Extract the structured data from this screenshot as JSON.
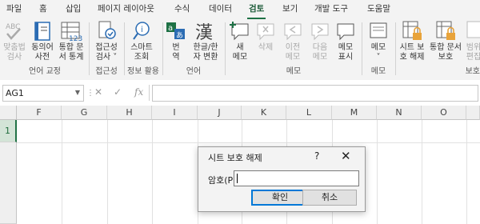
{
  "ribbon_tabs": [
    "파일",
    "홈",
    "삽입",
    "페이지 레이아웃",
    "수식",
    "데이터",
    "검토",
    "보기",
    "개발 도구",
    "도움말"
  ],
  "active_tab": "검토",
  "ribbon": {
    "buttons": {
      "spelling": "맞춤법\n검사",
      "thesaurus": "동의어\n사전",
      "workbook_stats": "통합 문\n서 통계",
      "accessibility": "접근성\n검사 ˅",
      "smart_lookup": "스마트\n조회",
      "translate": "번\n역",
      "hanja": "한글/한\n자 변환",
      "new_comment": "새\n메모",
      "delete_comment": "삭제",
      "prev_comment": "이전\n메모",
      "next_comment": "다음\n메모",
      "show_comments": "메모\n표시",
      "notes": "메모\n˅",
      "protect_sheet": "시트 보\n호 해제",
      "protect_workbook": "통합 문서\n보호",
      "allow_edit": "범위\n편집"
    },
    "groups": {
      "proofing": "언어 교정",
      "accessibility": "접근성",
      "insights": "정보 활용",
      "language": "언어",
      "comments": "메모",
      "notes": "메모",
      "protect": "보호"
    }
  },
  "formula_bar": {
    "name_box": "AG1",
    "fx": "fx",
    "cancel": "✕",
    "enter": "✓"
  },
  "sheet": {
    "columns": [
      "F",
      "G",
      "H",
      "I",
      "J",
      "K",
      "L",
      "M",
      "N",
      "O"
    ],
    "rows": [
      "1"
    ]
  },
  "dialog": {
    "title": "시트 보호 해제",
    "help": "?",
    "close": "✕",
    "password_label": "암호(P):",
    "ok": "확인",
    "cancel": "취소"
  },
  "colors": {
    "accent": "#217346",
    "icon_blue": "#2b6cb3",
    "icon_green": "#1e7145"
  }
}
